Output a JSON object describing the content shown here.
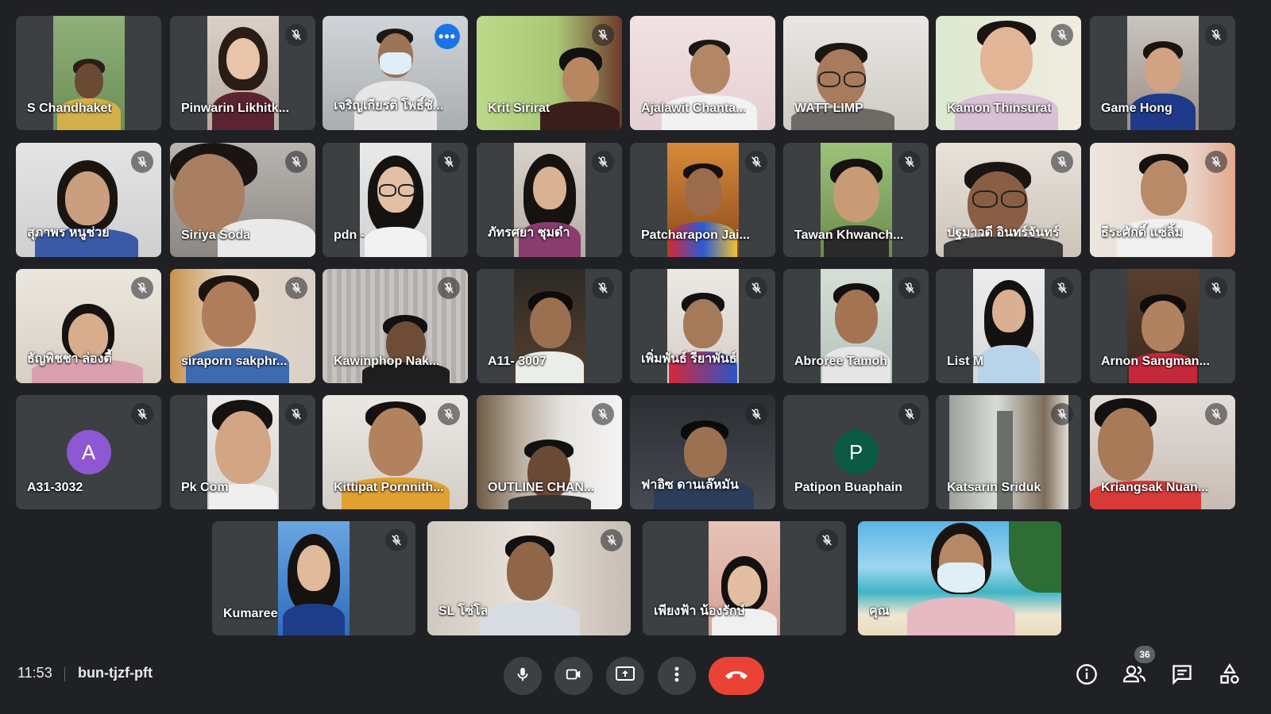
{
  "meeting": {
    "time": "11:53",
    "code": "bun-tjzf-pft",
    "participant_count": "36"
  },
  "colors": {
    "background": "#202124",
    "tile": "#3c4043",
    "end_call": "#ea4335",
    "active_border": "#8ab4f8",
    "more_button": "#1a73e8"
  },
  "participants": [
    {
      "name": "S Chandhaket",
      "muted": false
    },
    {
      "name": "Pinwarin Likhitk...",
      "muted": true
    },
    {
      "name": "เจริญเกียรติ โพธิ์ชั...",
      "muted": false,
      "active": true
    },
    {
      "name": "Krit Sirirat",
      "muted": true
    },
    {
      "name": "Ajalawit Chanta...",
      "muted": false
    },
    {
      "name": "WATT LIMP",
      "muted": false
    },
    {
      "name": "Kamon Thinsurat",
      "muted": true
    },
    {
      "name": "Game Hong",
      "muted": true
    },
    {
      "name": "สุภาพร หนูช่วย",
      "muted": true
    },
    {
      "name": "Siriya Soda",
      "muted": true
    },
    {
      "name": "pdn -",
      "muted": true
    },
    {
      "name": "ภัทรศยา ชุมดำ",
      "muted": true
    },
    {
      "name": "Patcharapon Jai...",
      "muted": true
    },
    {
      "name": "Tawan Khwanch...",
      "muted": true
    },
    {
      "name": "ปฐมาวดี อินทร์จันทร์",
      "muted": true
    },
    {
      "name": "ธีระศักดิ์ แซ่ลิ้ม",
      "muted": true
    },
    {
      "name": "ธัญพิชชา ล่องตี้",
      "muted": true
    },
    {
      "name": "siraporn sakphr...",
      "muted": true
    },
    {
      "name": "Kawinphop Nak...",
      "muted": true
    },
    {
      "name": "A11- 3007",
      "muted": true
    },
    {
      "name": "เพิ่มพันธ์ รียาพันธ์",
      "muted": true
    },
    {
      "name": "Abroree Tamoh",
      "muted": true
    },
    {
      "name": "List M",
      "muted": true
    },
    {
      "name": "Arnon Sangman...",
      "muted": true
    },
    {
      "name": "A31-3032",
      "muted": true,
      "avatar_letter": "A"
    },
    {
      "name": "Pk Com",
      "muted": true
    },
    {
      "name": "Kittipat Pornnith...",
      "muted": true
    },
    {
      "name": "OUTLINE CHAN...",
      "muted": true
    },
    {
      "name": "ฟาอิซ ดานเล๊หมัน",
      "muted": true
    },
    {
      "name": "Patipon Buaphain",
      "muted": true,
      "avatar_letter": "P"
    },
    {
      "name": "Katsarin Sriduk",
      "muted": true
    },
    {
      "name": "Kriangsak Nuan...",
      "muted": true
    },
    {
      "name": "Kumaree",
      "muted": true
    },
    {
      "name": "SL โซ่โล",
      "muted": true
    },
    {
      "name": "เพียงฟ้า น้องรักษ์",
      "muted": true
    },
    {
      "name": "คุณ",
      "muted": false
    }
  ],
  "icons": {
    "mic": "microphone-icon",
    "camera": "camera-icon",
    "present": "present-screen-icon",
    "more": "more-vert-icon",
    "end": "end-call-icon",
    "info": "info-icon",
    "people": "people-icon",
    "chat": "chat-icon",
    "activities": "activities-icon"
  }
}
